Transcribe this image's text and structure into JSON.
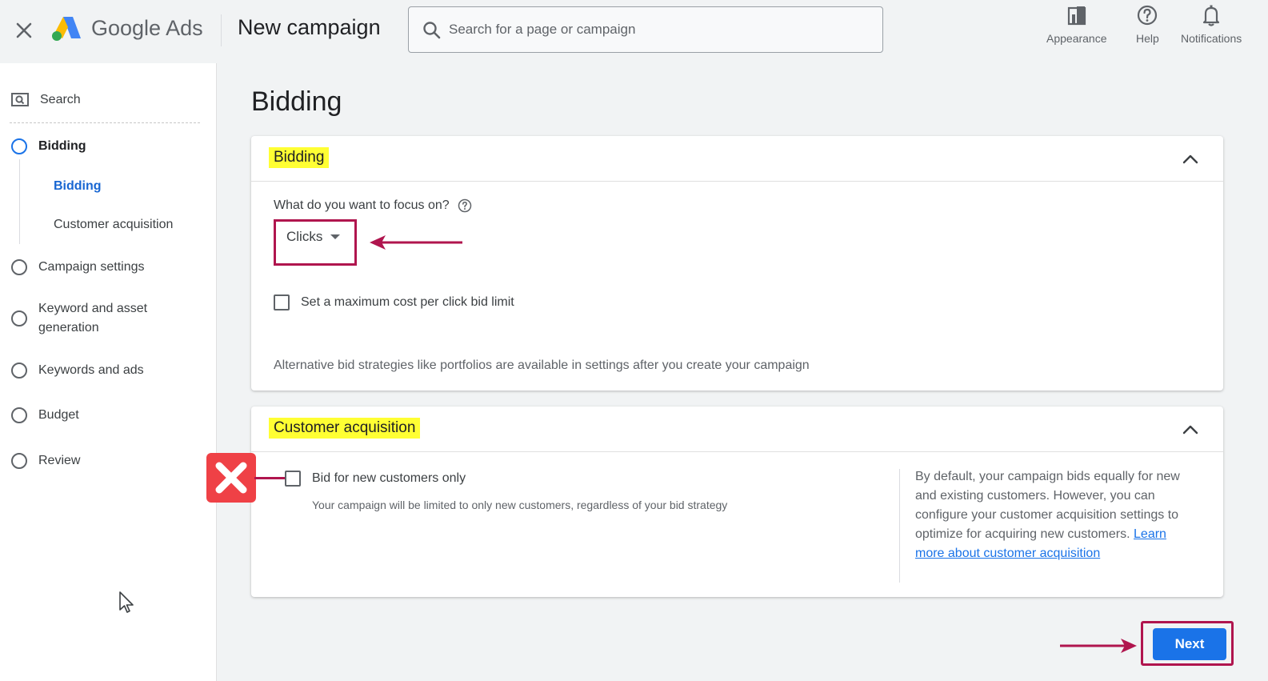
{
  "header": {
    "close_icon": "close-icon",
    "brand": "Google Ads",
    "title": "New campaign",
    "search_placeholder": "Search for a page or campaign",
    "tools": [
      {
        "label": "Appearance",
        "icon": "appearance-icon"
      },
      {
        "label": "Help",
        "icon": "help-icon"
      },
      {
        "label": "Notifications",
        "icon": "bell-icon"
      }
    ]
  },
  "sidebar": {
    "campaign_type": "Search",
    "steps": [
      {
        "label": "Bidding",
        "active": true
      },
      {
        "label": "Campaign settings"
      },
      {
        "label": "Keyword and asset generation"
      },
      {
        "label": "Keywords and ads"
      },
      {
        "label": "Budget"
      },
      {
        "label": "Review"
      }
    ],
    "substeps": [
      {
        "label": "Bidding",
        "active": true
      },
      {
        "label": "Customer acquisition"
      }
    ]
  },
  "main": {
    "page_title": "Bidding",
    "bidding_card": {
      "title": "Bidding",
      "question": "What do you want to focus on?",
      "focus_value": "Clicks",
      "max_cpc_label": "Set a maximum cost per click bid limit",
      "note": "Alternative bid strategies like portfolios are available in settings after you create your campaign"
    },
    "acquisition_card": {
      "title": "Customer acquisition",
      "checkbox_label": "Bid for new customers only",
      "checkbox_desc": "Your campaign will be limited to only new customers, regardless of your bid strategy",
      "side_text": "By default, your campaign bids equally for new and existing customers. However, you can configure your customer acquisition settings to optimize for acquiring new customers.",
      "learn_more": "Learn more about customer acquisition"
    },
    "next_label": "Next"
  },
  "colors": {
    "accent": "#1a73e8",
    "highlight": "#ffff33",
    "annotation": "#b0154e",
    "reject": "#ef4146"
  }
}
